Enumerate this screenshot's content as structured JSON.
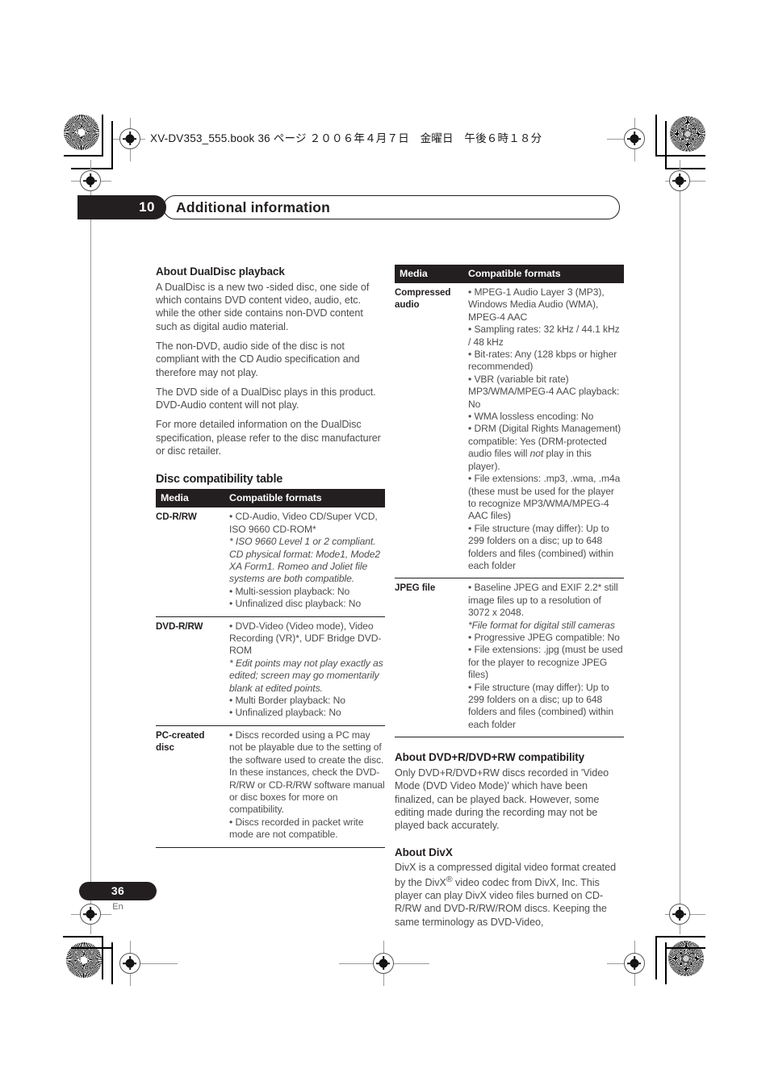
{
  "print_header": {
    "code": "XV-DV353_555.book 36 ページ ２００６年４月７日　金曜日　午後６時１８分"
  },
  "chapter": {
    "number": "10",
    "title": "Additional information"
  },
  "footer": {
    "page_number": "36",
    "language": "En"
  },
  "left_column": {
    "dualdisc": {
      "heading": "About DualDisc playback",
      "paragraphs": [
        "A DualDisc is a new two -sided disc, one side of which contains DVD content video, audio, etc. while the other side contains non-DVD content such as digital audio material.",
        "The non-DVD, audio side of the disc is not compliant with the CD Audio specification and therefore may not play.",
        "The DVD side of a DualDisc plays in this product. DVD-Audio content will not play.",
        "For more detailed information on the DualDisc specification, please refer to the disc manufacturer or disc retailer."
      ]
    },
    "table": {
      "title": "Disc compatibility table",
      "headers": [
        "Media",
        "Compatible formats"
      ],
      "rows": [
        {
          "media": "CD-R/RW",
          "lines": [
            {
              "type": "bullet",
              "text": "CD-Audio, Video CD/Super VCD, ISO 9660 CD-ROM*"
            },
            {
              "type": "italic",
              "text": "* ISO 9660 Level 1 or 2 compliant. CD physical format: Mode1, Mode2 XA Form1. Romeo and Joliet file systems are both compatible."
            },
            {
              "type": "bullet",
              "text": "Multi-session playback: No"
            },
            {
              "type": "bullet",
              "text": "Unfinalized disc playback: No"
            }
          ]
        },
        {
          "media": "DVD-R/RW",
          "lines": [
            {
              "type": "bullet",
              "text": "DVD-Video (Video mode), Video Recording (VR)*, UDF Bridge DVD-ROM"
            },
            {
              "type": "italic",
              "text": "* Edit points may not play exactly as edited; screen may go momentarily blank at edited points."
            },
            {
              "type": "bullet",
              "text": "Multi Border playback: No"
            },
            {
              "type": "bullet",
              "text": "Unfinalized playback: No"
            }
          ]
        },
        {
          "media": "PC-created disc",
          "lines": [
            {
              "type": "bullet",
              "text": "Discs recorded using a PC may not be playable due to the setting of the software used to create the disc. In these instances, check the DVD-R/RW or CD-R/RW software manual or disc boxes for more on compatibility."
            },
            {
              "type": "bullet",
              "text": "Discs recorded in packet write mode are not compatible."
            }
          ]
        }
      ]
    }
  },
  "right_column": {
    "table": {
      "headers": [
        "Media",
        "Compatible formats"
      ],
      "rows": [
        {
          "media": "Compressed audio",
          "lines": [
            {
              "type": "bullet",
              "text": "MPEG-1 Audio Layer 3 (MP3), Windows Media Audio (WMA), MPEG-4 AAC"
            },
            {
              "type": "bullet",
              "text": "Sampling rates: 32 kHz / 44.1 kHz / 48 kHz"
            },
            {
              "type": "bullet",
              "text": "Bit-rates: Any (128 kbps or higher recommended)"
            },
            {
              "type": "bullet",
              "text": "VBR (variable bit rate) MP3/WMA/MPEG-4 AAC playback: No"
            },
            {
              "type": "bullet",
              "text": "WMA lossless encoding: No"
            },
            {
              "type": "bullet_mixed",
              "pre": "DRM (Digital Rights Management) compatible: Yes (DRM-protected audio files will ",
              "em": "not",
              "post": " play in this player)."
            },
            {
              "type": "bullet",
              "text": "File extensions: .mp3, .wma, .m4a (these must be used for the player to recognize MP3/WMA/MPEG-4 AAC files)"
            },
            {
              "type": "bullet",
              "text": "File structure (may differ): Up to 299 folders on a disc; up to 648 folders and files (combined) within each folder"
            }
          ]
        },
        {
          "media": "JPEG file",
          "lines": [
            {
              "type": "bullet",
              "text": "Baseline JPEG and EXIF 2.2* still image files up to a resolution of 3072 x 2048."
            },
            {
              "type": "italic",
              "text": "*File format for digital still cameras"
            },
            {
              "type": "bullet",
              "text": "Progressive JPEG compatible: No"
            },
            {
              "type": "bullet",
              "text": "File extensions: .jpg (must be used for the player to recognize JPEG files)"
            },
            {
              "type": "bullet",
              "text": "File structure (may differ): Up to 299 folders on a disc; up to 648 folders and files (combined) within each folder"
            }
          ]
        }
      ]
    },
    "dvd_plus": {
      "heading": "About DVD+R/DVD+RW compatibility",
      "paragraph": "Only DVD+R/DVD+RW discs recorded in 'Video Mode (DVD Video Mode)' which have been finalized, can be played back. However, some editing made during the recording may not be played back accurately."
    },
    "divx": {
      "heading": "About DivX",
      "paragraph_pre": "DivX is a compressed digital video format created by the DivX",
      "superscript": "®",
      "paragraph_post": " video codec from DivX, Inc. This player can play DivX video files burned on CD-R/RW and DVD-R/RW/ROM discs. Keeping the same terminology as DVD-Video,"
    }
  },
  "colors": {
    "ink_black": "#231f20",
    "body_gray": "#4c4c4e",
    "mark_gray": "#9a9a9a"
  }
}
